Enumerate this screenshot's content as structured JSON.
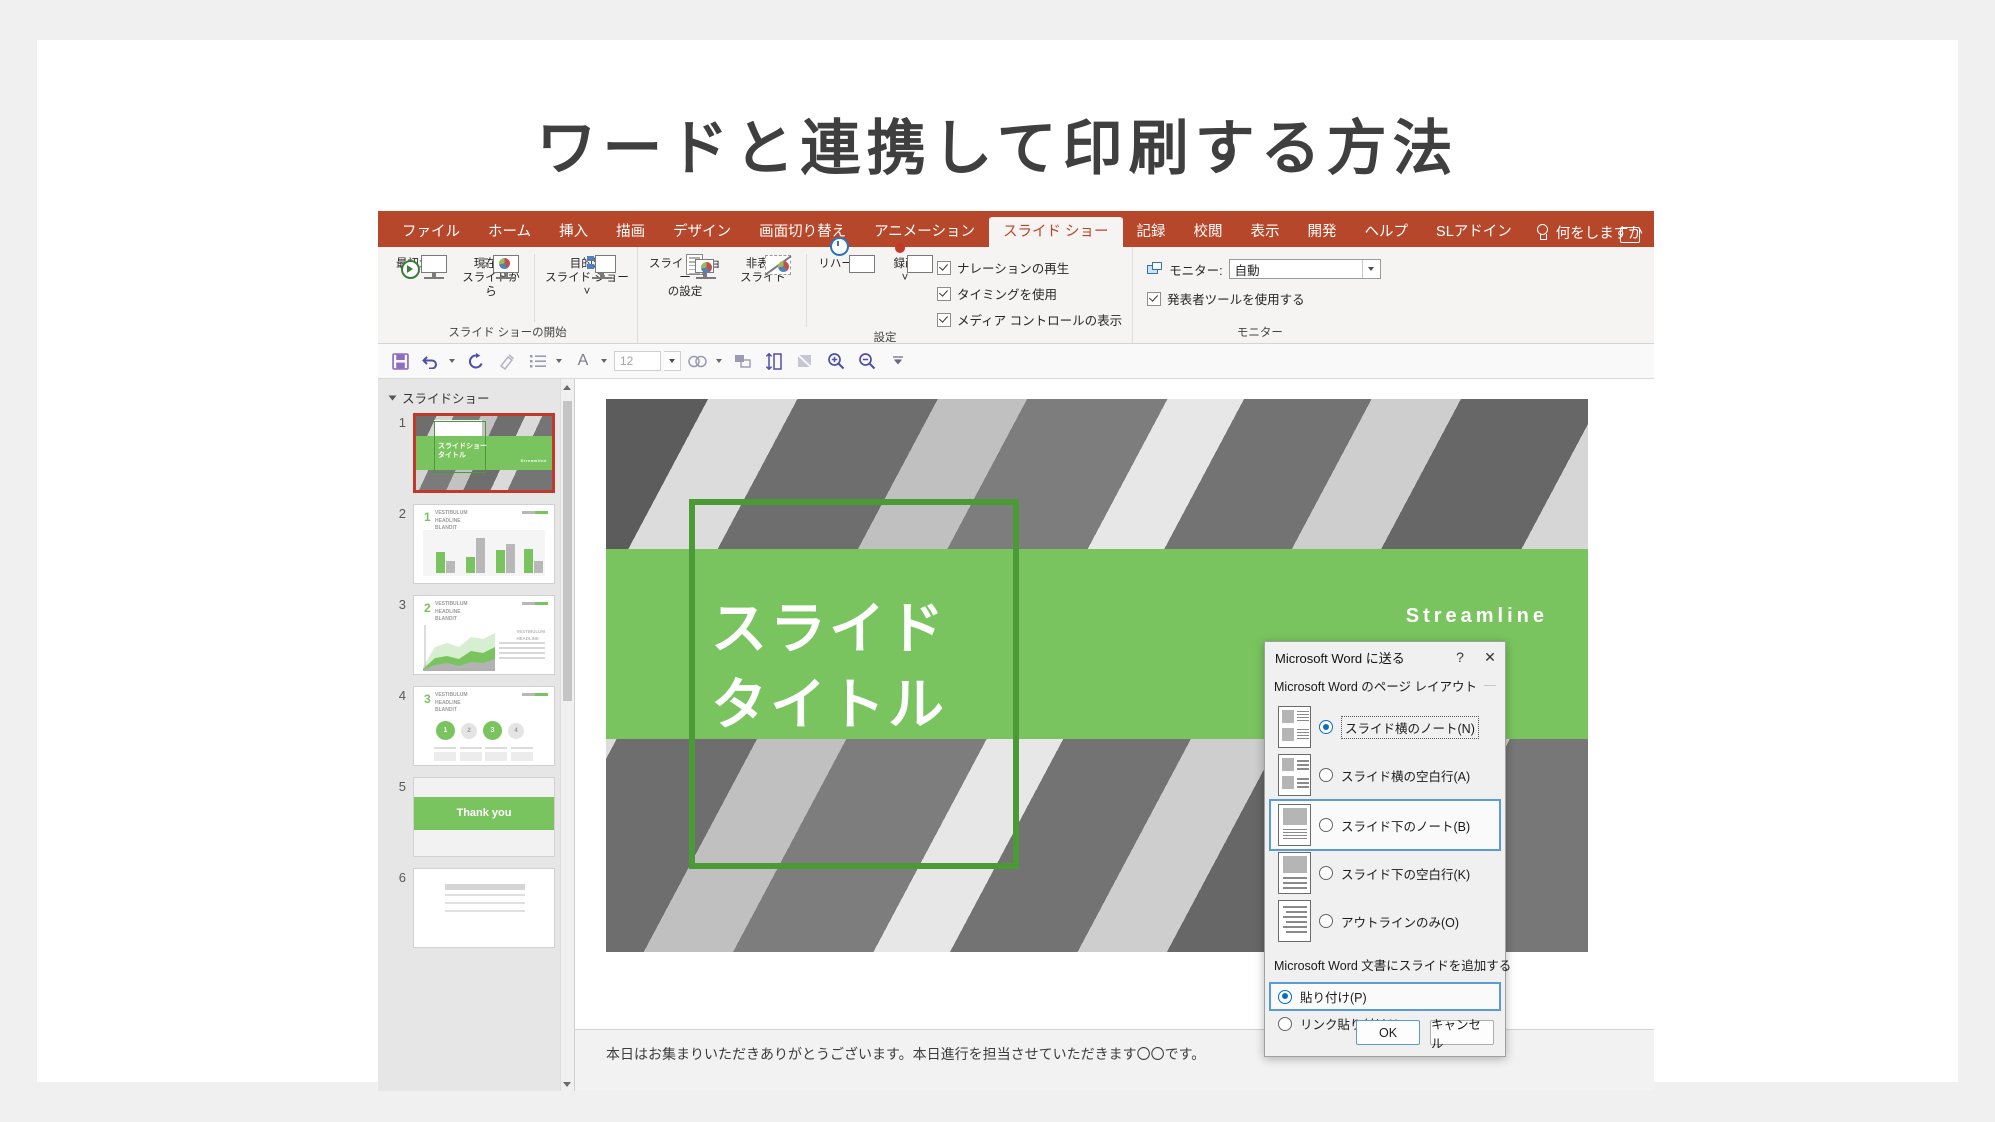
{
  "headline": "ワードと連携して印刷する方法",
  "ribbon": {
    "tabs": [
      {
        "label": "ファイル",
        "active": false
      },
      {
        "label": "ホーム",
        "active": false
      },
      {
        "label": "挿入",
        "active": false
      },
      {
        "label": "描画",
        "active": false
      },
      {
        "label": "デザイン",
        "active": false
      },
      {
        "label": "画面切り替え",
        "active": false
      },
      {
        "label": "アニメーション",
        "active": false
      },
      {
        "label": "スライド ショー",
        "active": true
      },
      {
        "label": "記録",
        "active": false
      },
      {
        "label": "校閲",
        "active": false
      },
      {
        "label": "表示",
        "active": false
      },
      {
        "label": "開発",
        "active": false
      },
      {
        "label": "ヘルプ",
        "active": false
      },
      {
        "label": "SLアドイン",
        "active": false
      }
    ],
    "tell_me": "何をしますか",
    "groups": [
      {
        "name": "スライド ショーの開始",
        "buttons": [
          {
            "label": "最初から"
          },
          {
            "label": "現在の\nスライドから"
          },
          {
            "label": "目的別\nスライド ショー ˅"
          }
        ]
      },
      {
        "name": "設定",
        "buttons": [
          {
            "label": "スライド ショー\nの設定"
          },
          {
            "label": "非表示\nスライド"
          },
          {
            "label": "リハーサル"
          },
          {
            "label": "録画\n˅"
          }
        ],
        "checkboxes": [
          {
            "label": "ナレーションの再生",
            "checked": true
          },
          {
            "label": "タイミングを使用",
            "checked": true
          },
          {
            "label": "メディア コントロールの表示",
            "checked": true
          }
        ]
      },
      {
        "name": "モニター",
        "monitor_label": "モニター:",
        "monitor_value": "自動",
        "checkboxes": [
          {
            "label": "発表者ツールを使用する",
            "checked": true
          }
        ]
      }
    ]
  },
  "quick_toolbar": {
    "buttons": [
      {
        "icon": "save-icon",
        "label": "保存"
      },
      {
        "icon": "undo-icon",
        "label": "元に戻す"
      },
      {
        "icon": "redo-icon",
        "label": "やり直し"
      },
      {
        "icon": "format-painter-icon",
        "label": "書式のコピー"
      },
      {
        "icon": "bullets-icon",
        "label": "箇条書き"
      },
      {
        "icon": "font-icon",
        "label": "フォント"
      },
      {
        "icon": "shapes-icon",
        "label": "図形"
      },
      {
        "icon": "arrange-icon",
        "label": "配置"
      },
      {
        "icon": "line-spacing-icon",
        "label": "行間"
      },
      {
        "icon": "crop-icon",
        "label": "トリミング"
      },
      {
        "icon": "zoom-in-icon",
        "label": "拡大"
      },
      {
        "icon": "zoom-out-icon",
        "label": "縮小"
      },
      {
        "icon": "overflow-icon",
        "label": "その他"
      }
    ],
    "font_size": "12"
  },
  "thumbnails": {
    "section": "スライドショー",
    "slides": [
      {
        "number": "1",
        "selected": true,
        "kind": "title",
        "title": "スライドショー\nタイトル",
        "brand": "Streamline"
      },
      {
        "number": "2",
        "selected": false,
        "kind": "bar",
        "num": "1",
        "heading": "VESTIBULUM\nHEADLINE\nBLANDIT"
      },
      {
        "number": "3",
        "selected": false,
        "kind": "area",
        "num": "2",
        "heading": "VESTIBULUM\nHEADLINE\nBLANDIT",
        "side": "VESTIBULUM\nHEADLINE"
      },
      {
        "number": "4",
        "selected": false,
        "kind": "steps",
        "num": "3",
        "heading": "VESTIBULUM\nHEADLINE\nBLANDIT",
        "steps": [
          "1",
          "2",
          "3",
          "4"
        ]
      },
      {
        "number": "5",
        "selected": false,
        "kind": "thanks",
        "text": "Thank you"
      },
      {
        "number": "6",
        "selected": false,
        "kind": "table"
      }
    ]
  },
  "slide": {
    "title": "スライド\nタイトル",
    "brand": "Streamline"
  },
  "notes": "本日はお集まりいただきありがとうございます。本日進行を担当させていただきます〇〇です。",
  "dialog": {
    "title": "Microsoft Word に送る",
    "help_glyph": "?",
    "close_glyph": "✕",
    "layout_group": "Microsoft Word のページ レイアウト",
    "layout_options": [
      {
        "label": "スライド横のノート(N)",
        "key": "N",
        "selected": true,
        "focused": true,
        "highlighted": false,
        "preview": "notes-beside"
      },
      {
        "label": "スライド横の空白行(A)",
        "key": "A",
        "selected": false,
        "focused": false,
        "highlighted": false,
        "preview": "blanklines-beside"
      },
      {
        "label": "スライド下のノート(B)",
        "key": "B",
        "selected": false,
        "focused": false,
        "highlighted": true,
        "preview": "notes-below"
      },
      {
        "label": "スライド下の空白行(K)",
        "key": "K",
        "selected": false,
        "focused": false,
        "highlighted": false,
        "preview": "blanklines-below"
      },
      {
        "label": "アウトラインのみ(O)",
        "key": "O",
        "selected": false,
        "focused": false,
        "highlighted": false,
        "preview": "outline-only"
      }
    ],
    "paste_group": "Microsoft Word 文書にスライドを追加する",
    "paste_options": [
      {
        "label": "貼り付け(P)",
        "key": "P",
        "selected": true,
        "highlighted": true
      },
      {
        "label": "リンク貼り付け(I)",
        "key": "I",
        "selected": false,
        "highlighted": false
      }
    ],
    "ok": "OK",
    "cancel": "キャンセル"
  },
  "colors": {
    "ribbon": "#b7472a",
    "accent_green": "#7ac45f",
    "frame_green": "#4a9a36",
    "highlight_blue": "#5b9bd5",
    "radio_blue": "#0a6ebd",
    "selected_thumb": "#c0392b"
  }
}
